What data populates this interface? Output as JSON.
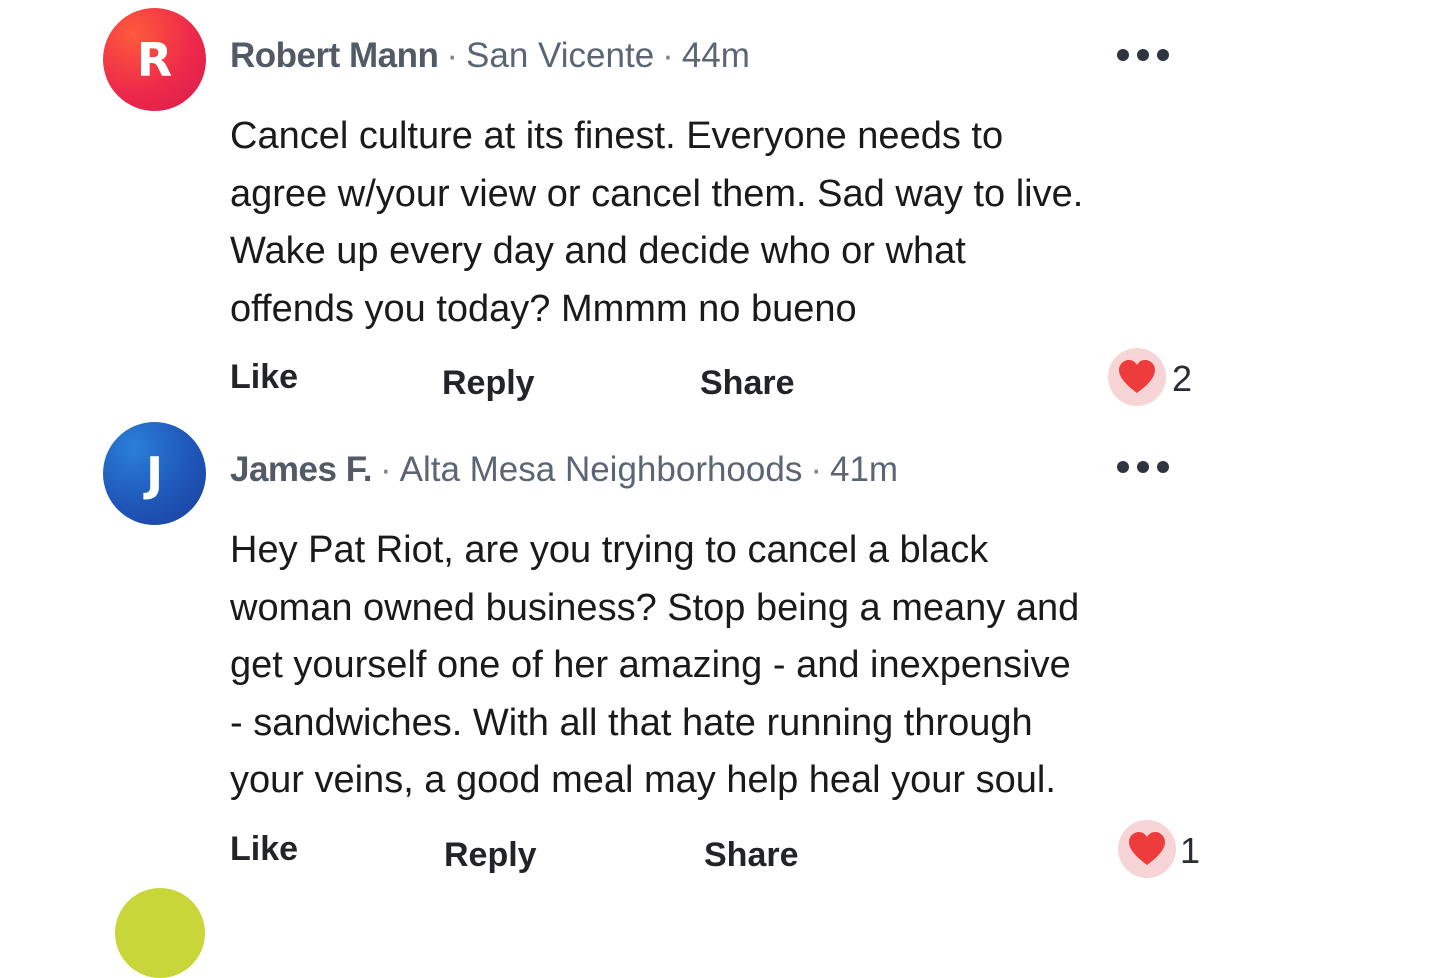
{
  "comments": [
    {
      "avatar_letter": "R",
      "author": "Robert Mann",
      "location": "San Vicente",
      "time": "44m",
      "body_lines": [
        "Cancel culture at its finest.  Everyone needs to",
        "agree w/your view or cancel them. Sad way to live.",
        "Wake up every day and decide who or what",
        "offends you today?  Mmmm no bueno"
      ],
      "actions": {
        "like": "Like",
        "reply": "Reply",
        "share": "Share"
      },
      "reaction_icon": "heart-icon",
      "reaction_count": "2"
    },
    {
      "avatar_letter": "J",
      "author": "James F.",
      "location": "Alta Mesa Neighborhoods",
      "time": "41m",
      "body_lines": [
        "Hey Pat Riot, are you trying to cancel a black",
        "woman owned business?  Stop being a meany and",
        "get yourself one of her amazing - and inexpensive",
        "- sandwiches.  With all that hate running through",
        "your veins, a good meal may help heal your soul."
      ],
      "actions": {
        "like": "Like",
        "reply": "Reply",
        "share": "Share"
      },
      "reaction_icon": "heart-icon",
      "reaction_count": "1"
    }
  ],
  "meta_separator": "·",
  "colors": {
    "heart": "#ee3b3b",
    "reaction_bg": "#f7d4d6",
    "avatar_r": "#ee2a4a",
    "avatar_j": "#1f56b8",
    "next_avatar": "#c8d63a"
  }
}
